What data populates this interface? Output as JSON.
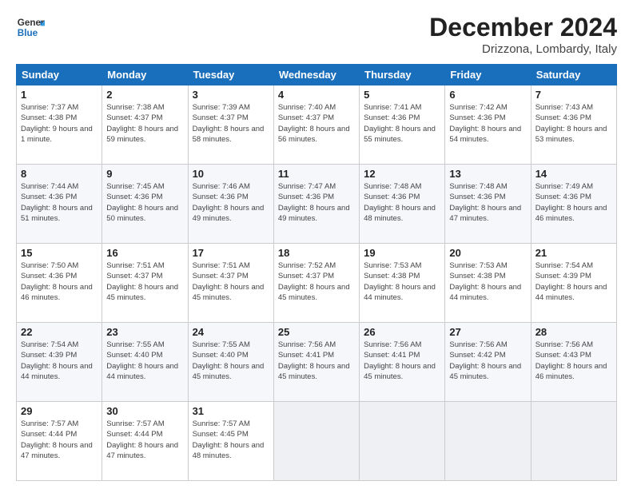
{
  "header": {
    "logo_general": "General",
    "logo_blue": "Blue",
    "month_title": "December 2024",
    "location": "Drizzona, Lombardy, Italy"
  },
  "columns": [
    "Sunday",
    "Monday",
    "Tuesday",
    "Wednesday",
    "Thursday",
    "Friday",
    "Saturday"
  ],
  "weeks": [
    [
      {
        "day": "1",
        "sunrise": "7:37 AM",
        "sunset": "4:38 PM",
        "daylight": "9 hours and 1 minute."
      },
      {
        "day": "2",
        "sunrise": "7:38 AM",
        "sunset": "4:37 PM",
        "daylight": "8 hours and 59 minutes."
      },
      {
        "day": "3",
        "sunrise": "7:39 AM",
        "sunset": "4:37 PM",
        "daylight": "8 hours and 58 minutes."
      },
      {
        "day": "4",
        "sunrise": "7:40 AM",
        "sunset": "4:37 PM",
        "daylight": "8 hours and 56 minutes."
      },
      {
        "day": "5",
        "sunrise": "7:41 AM",
        "sunset": "4:36 PM",
        "daylight": "8 hours and 55 minutes."
      },
      {
        "day": "6",
        "sunrise": "7:42 AM",
        "sunset": "4:36 PM",
        "daylight": "8 hours and 54 minutes."
      },
      {
        "day": "7",
        "sunrise": "7:43 AM",
        "sunset": "4:36 PM",
        "daylight": "8 hours and 53 minutes."
      }
    ],
    [
      {
        "day": "8",
        "sunrise": "7:44 AM",
        "sunset": "4:36 PM",
        "daylight": "8 hours and 51 minutes."
      },
      {
        "day": "9",
        "sunrise": "7:45 AM",
        "sunset": "4:36 PM",
        "daylight": "8 hours and 50 minutes."
      },
      {
        "day": "10",
        "sunrise": "7:46 AM",
        "sunset": "4:36 PM",
        "daylight": "8 hours and 49 minutes."
      },
      {
        "day": "11",
        "sunrise": "7:47 AM",
        "sunset": "4:36 PM",
        "daylight": "8 hours and 49 minutes."
      },
      {
        "day": "12",
        "sunrise": "7:48 AM",
        "sunset": "4:36 PM",
        "daylight": "8 hours and 48 minutes."
      },
      {
        "day": "13",
        "sunrise": "7:48 AM",
        "sunset": "4:36 PM",
        "daylight": "8 hours and 47 minutes."
      },
      {
        "day": "14",
        "sunrise": "7:49 AM",
        "sunset": "4:36 PM",
        "daylight": "8 hours and 46 minutes."
      }
    ],
    [
      {
        "day": "15",
        "sunrise": "7:50 AM",
        "sunset": "4:36 PM",
        "daylight": "8 hours and 46 minutes."
      },
      {
        "day": "16",
        "sunrise": "7:51 AM",
        "sunset": "4:37 PM",
        "daylight": "8 hours and 45 minutes."
      },
      {
        "day": "17",
        "sunrise": "7:51 AM",
        "sunset": "4:37 PM",
        "daylight": "8 hours and 45 minutes."
      },
      {
        "day": "18",
        "sunrise": "7:52 AM",
        "sunset": "4:37 PM",
        "daylight": "8 hours and 45 minutes."
      },
      {
        "day": "19",
        "sunrise": "7:53 AM",
        "sunset": "4:38 PM",
        "daylight": "8 hours and 44 minutes."
      },
      {
        "day": "20",
        "sunrise": "7:53 AM",
        "sunset": "4:38 PM",
        "daylight": "8 hours and 44 minutes."
      },
      {
        "day": "21",
        "sunrise": "7:54 AM",
        "sunset": "4:39 PM",
        "daylight": "8 hours and 44 minutes."
      }
    ],
    [
      {
        "day": "22",
        "sunrise": "7:54 AM",
        "sunset": "4:39 PM",
        "daylight": "8 hours and 44 minutes."
      },
      {
        "day": "23",
        "sunrise": "7:55 AM",
        "sunset": "4:40 PM",
        "daylight": "8 hours and 44 minutes."
      },
      {
        "day": "24",
        "sunrise": "7:55 AM",
        "sunset": "4:40 PM",
        "daylight": "8 hours and 45 minutes."
      },
      {
        "day": "25",
        "sunrise": "7:56 AM",
        "sunset": "4:41 PM",
        "daylight": "8 hours and 45 minutes."
      },
      {
        "day": "26",
        "sunrise": "7:56 AM",
        "sunset": "4:41 PM",
        "daylight": "8 hours and 45 minutes."
      },
      {
        "day": "27",
        "sunrise": "7:56 AM",
        "sunset": "4:42 PM",
        "daylight": "8 hours and 45 minutes."
      },
      {
        "day": "28",
        "sunrise": "7:56 AM",
        "sunset": "4:43 PM",
        "daylight": "8 hours and 46 minutes."
      }
    ],
    [
      {
        "day": "29",
        "sunrise": "7:57 AM",
        "sunset": "4:44 PM",
        "daylight": "8 hours and 47 minutes."
      },
      {
        "day": "30",
        "sunrise": "7:57 AM",
        "sunset": "4:44 PM",
        "daylight": "8 hours and 47 minutes."
      },
      {
        "day": "31",
        "sunrise": "7:57 AM",
        "sunset": "4:45 PM",
        "daylight": "8 hours and 48 minutes."
      },
      null,
      null,
      null,
      null
    ]
  ]
}
